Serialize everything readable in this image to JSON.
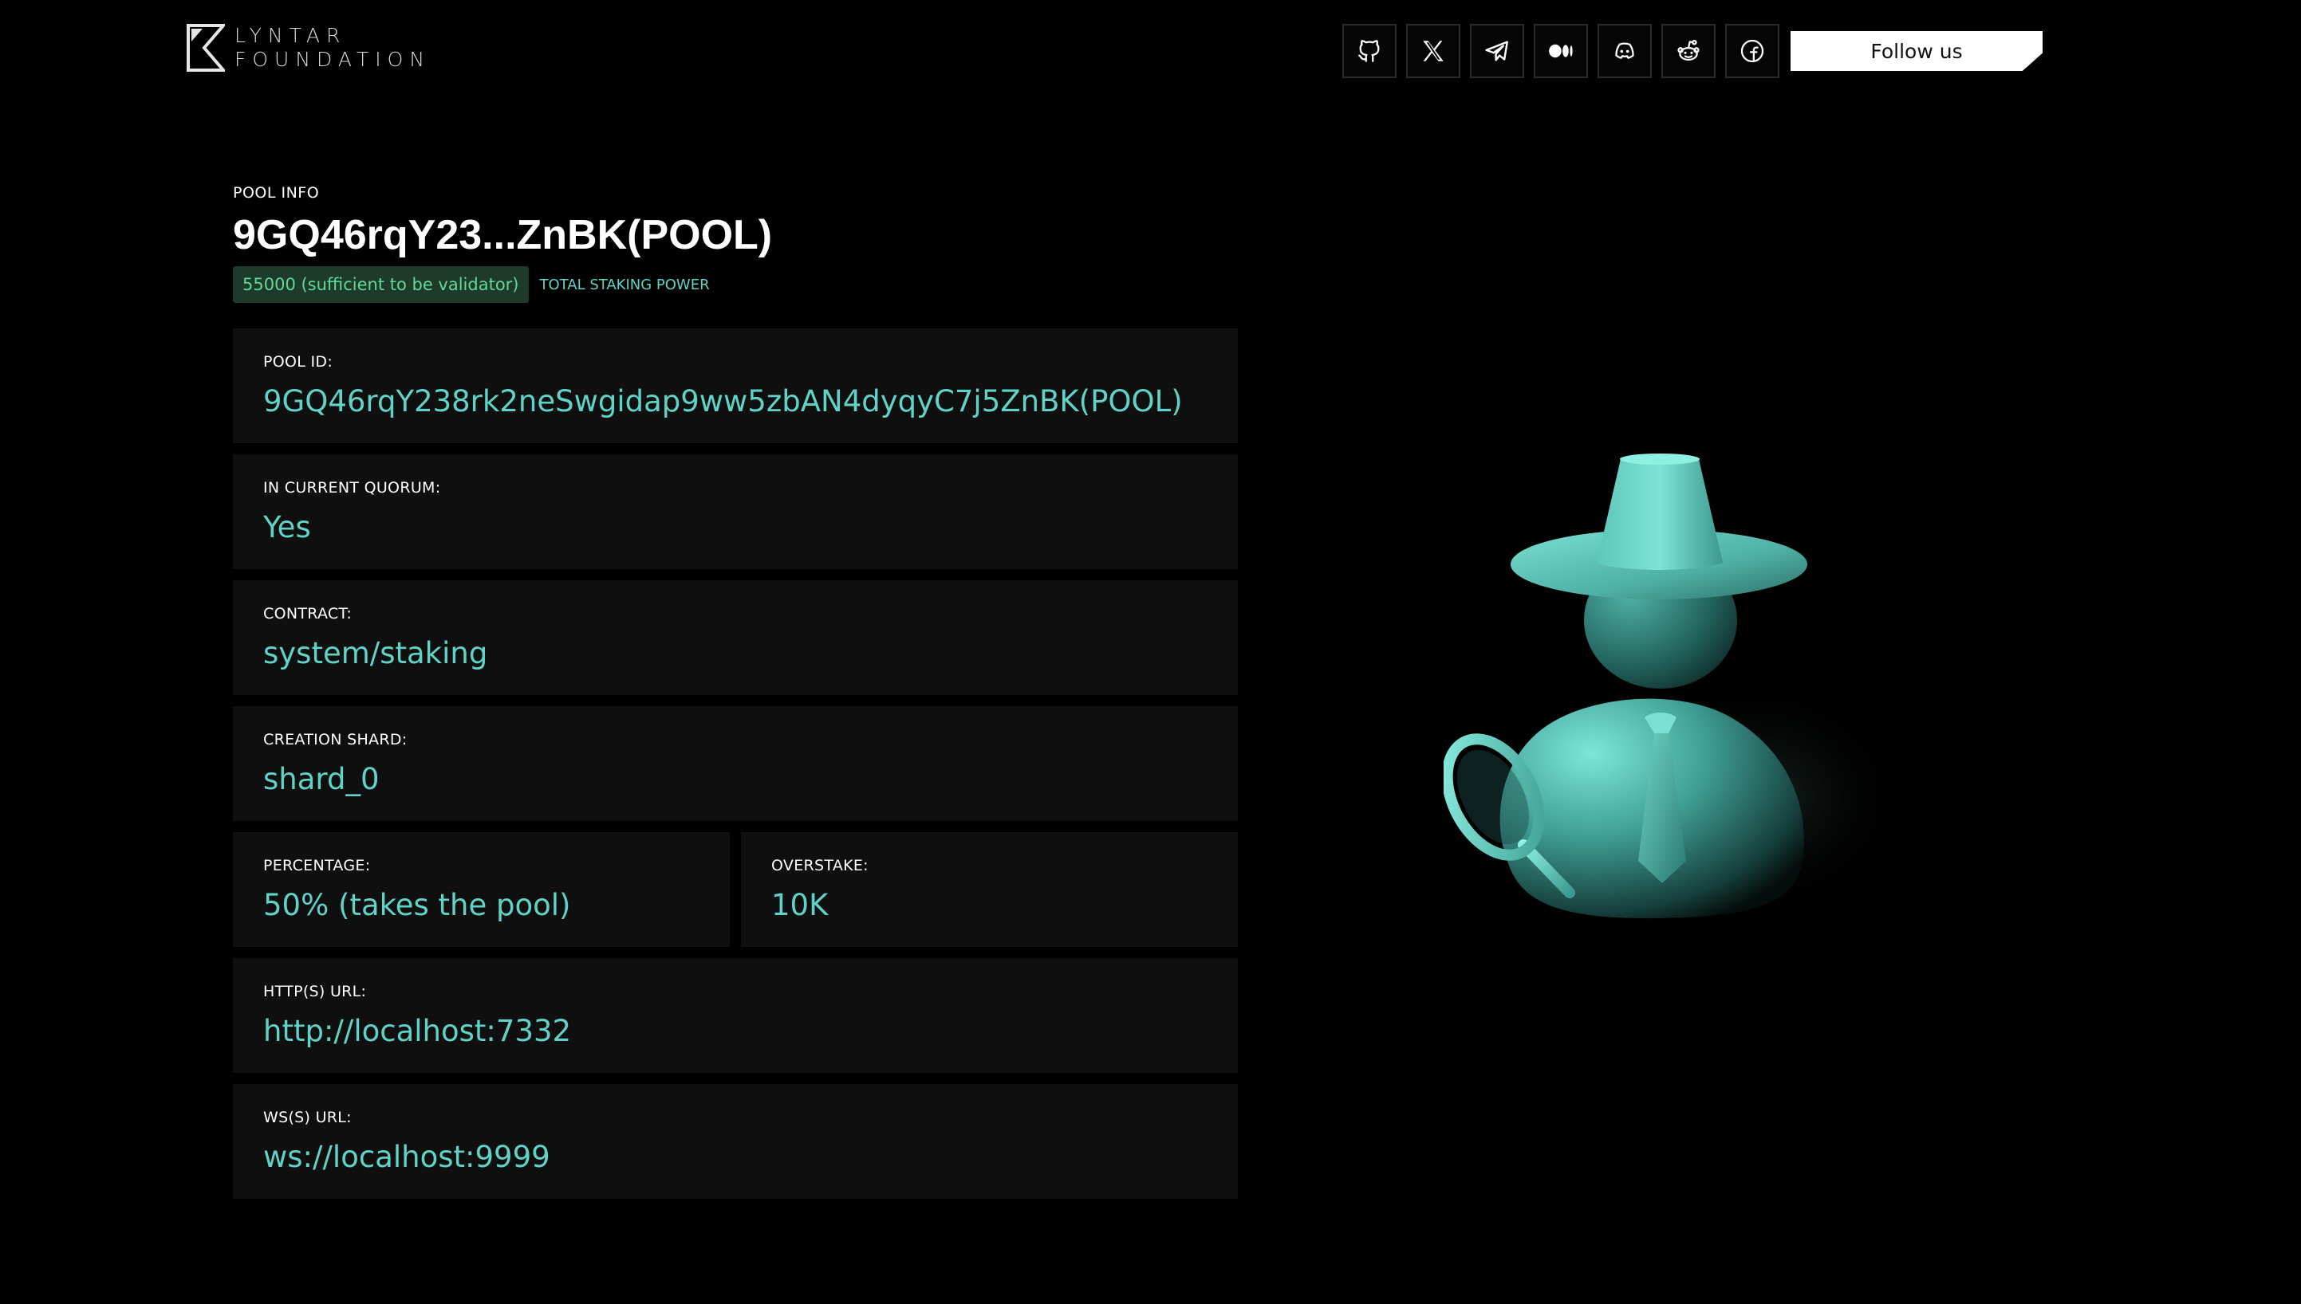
{
  "brand": {
    "line1": "LYNTAR",
    "line2": "FOUNDATION"
  },
  "header": {
    "social_icons": [
      {
        "name": "github-icon"
      },
      {
        "name": "x-twitter-icon"
      },
      {
        "name": "telegram-icon"
      },
      {
        "name": "medium-icon"
      },
      {
        "name": "discord-icon"
      },
      {
        "name": "reddit-icon"
      },
      {
        "name": "facebook-icon"
      }
    ],
    "follow_label": "Follow us"
  },
  "pool": {
    "eyebrow": "POOL INFO",
    "title": "9GQ46rqY23...ZnBK(POOL)",
    "stake_badge": "55000 (sufficient to be validator)",
    "stake_caption": "TOTAL STAKING POWER"
  },
  "fields": {
    "pool_id": {
      "label": "POOL ID:",
      "value": "9GQ46rqY238rk2neSwgidap9ww5zbAN4dyqyC7j5ZnBK(POOL)"
    },
    "quorum": {
      "label": "IN CURRENT QUORUM:",
      "value": "Yes"
    },
    "contract": {
      "label": "CONTRACT:",
      "value": "system/staking"
    },
    "shard": {
      "label": "CREATION SHARD:",
      "value": "shard_0"
    },
    "percentage": {
      "label": "PERCENTAGE:",
      "value": "50% (takes the pool)"
    },
    "overstake": {
      "label": "OVERSTAKE:",
      "value": "10K"
    },
    "http_url": {
      "label": "HTTP(S) URL:",
      "value": "http://localhost:7332"
    },
    "ws_url": {
      "label": "WS(S) URL:",
      "value": "ws://localhost:9999"
    }
  },
  "colors": {
    "background": "#000000",
    "accent": "#5fd3c6",
    "card": "#0f0f0f",
    "badge_bg": "#1e3a2a",
    "badge_text": "#5fd89a"
  },
  "illustration": {
    "icon": "detective-icon"
  }
}
